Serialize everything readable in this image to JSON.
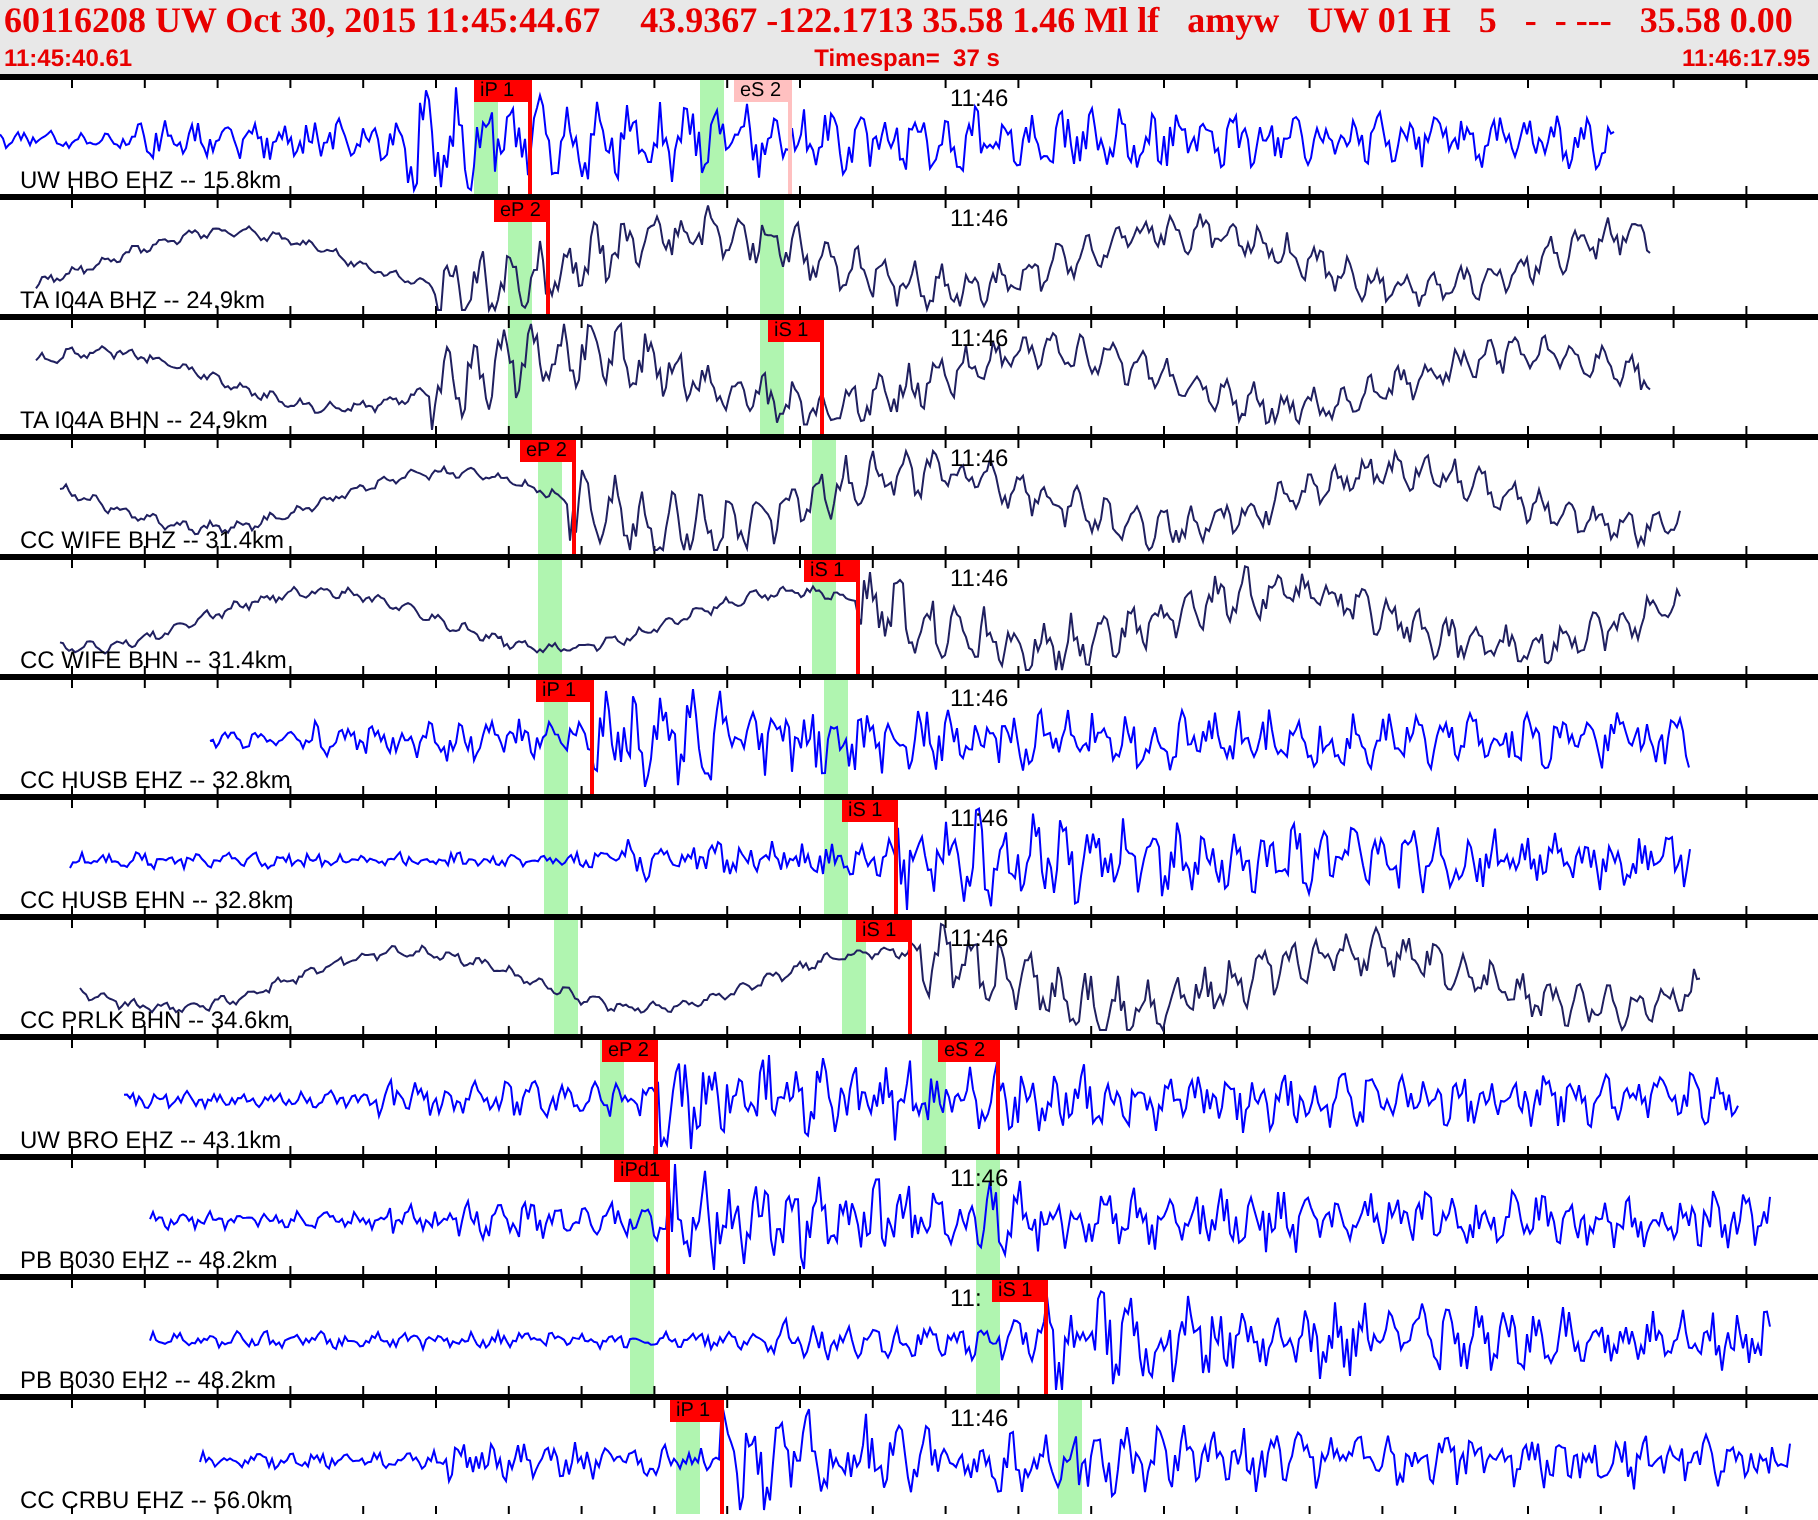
{
  "header": {
    "fields": [
      "60116208 UW Oct 30, 2015 11:45:44.67",
      "43.9367 -122.1713 35.58 1.46 Ml lf",
      "amyw",
      "UW 01 H",
      "5",
      "-  - ---",
      "35.58 0.00"
    ],
    "start_time": "11:45:40.61",
    "timespan": "Timespan=  37 s",
    "end_time": "11:46:17.95"
  },
  "traces": [
    {
      "label": "UW HBO EHZ -- 15.8km",
      "time_mark": "11:46",
      "color": "#0000ff",
      "picks": [
        {
          "label": "iP 1",
          "color": "#ff0000"
        },
        {
          "label": "eS 2",
          "color": "#ffc0c0"
        }
      ]
    },
    {
      "label": "TA I04A BHZ -- 24.9km",
      "time_mark": "11:46",
      "color": "#202060",
      "picks": [
        {
          "label": "eP 2",
          "color": "#ff0000"
        }
      ]
    },
    {
      "label": "TA I04A BHN -- 24.9km",
      "time_mark": "11:46",
      "color": "#202060",
      "picks": [
        {
          "label": "iS 1",
          "color": "#ff0000"
        }
      ]
    },
    {
      "label": "CC WIFE BHZ -- 31.4km",
      "time_mark": "11:46",
      "color": "#202060",
      "picks": [
        {
          "label": "eP 2",
          "color": "#ff0000"
        }
      ]
    },
    {
      "label": "CC WIFE BHN -- 31.4km",
      "time_mark": "11:46",
      "color": "#202060",
      "picks": [
        {
          "label": "iS 1",
          "color": "#ff0000"
        }
      ]
    },
    {
      "label": "CC HUSB EHZ -- 32.8km",
      "time_mark": "11:46",
      "color": "#0000ff",
      "picks": [
        {
          "label": "iP 1",
          "color": "#ff0000"
        }
      ]
    },
    {
      "label": "CC HUSB EHN -- 32.8km",
      "time_mark": "11:46",
      "color": "#0000ff",
      "picks": [
        {
          "label": "iS 1",
          "color": "#ff0000"
        }
      ]
    },
    {
      "label": "CC PRLK BHN -- 34.6km",
      "time_mark": "11:46",
      "color": "#202060",
      "picks": [
        {
          "label": "iS 1",
          "color": "#ff0000"
        }
      ]
    },
    {
      "label": "UW BRO EHZ -- 43.1km",
      "color": "#0000ff",
      "picks": [
        {
          "label": "eP 2",
          "color": "#ff0000"
        },
        {
          "label": "eS 2",
          "color": "#ff0000"
        }
      ]
    },
    {
      "label": "PB B030 EHZ -- 48.2km",
      "time_mark": "11:46",
      "color": "#0000ff",
      "picks": [
        {
          "label": "iPd1",
          "color": "#ff0000"
        }
      ]
    },
    {
      "label": "PB B030 EH2 -- 48.2km",
      "time_mark": "11:",
      "color": "#0000ff",
      "picks": [
        {
          "label": "iS 1",
          "color": "#ff0000"
        }
      ]
    },
    {
      "label": "CC CRBU EHZ -- 56.0km",
      "time_mark": "11:46",
      "color": "#0000ff",
      "picks": [
        {
          "label": "iP 1",
          "color": "#ff0000"
        }
      ]
    }
  ]
}
